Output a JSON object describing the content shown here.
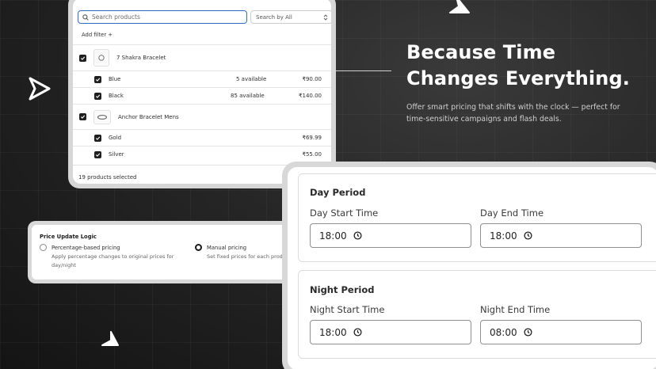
{
  "search": {
    "placeholder": "Search products",
    "filter_label": "Search by All",
    "add_filter": "Add filter +"
  },
  "products": [
    {
      "name": "7 Shakra Bracelet",
      "variants": [
        {
          "name": "Blue",
          "available": "5 available",
          "price": "₹90.00"
        },
        {
          "name": "Black",
          "available": "85 available",
          "price": "₹140.00"
        }
      ]
    },
    {
      "name": "Anchor Bracelet Mens",
      "variants": [
        {
          "name": "Gold",
          "available": "",
          "price": "₹69.99"
        },
        {
          "name": "Silver",
          "available": "",
          "price": "₹55.00"
        }
      ]
    }
  ],
  "footer": {
    "selected": "19 products selected"
  },
  "headline": {
    "line1": "Because Time",
    "line2": "Changes Everything.",
    "subtext": "Offer smart pricing that shifts with the clock — perfect for time-sensitive campaigns and flash deals."
  },
  "price_logic": {
    "title": "Price Update Logic",
    "options": [
      {
        "label": "Percentage-based pricing",
        "desc": "Apply percentage changes to original prices for day/night",
        "selected": false
      },
      {
        "label": "Manual pricing",
        "desc": "Set fixed prices for each product variant",
        "selected": true
      }
    ]
  },
  "day_period": {
    "title": "Day Period",
    "start_label": "Day Start Time",
    "start_value": "18:00",
    "end_label": "Day End Time",
    "end_value": "18:00"
  },
  "night_period": {
    "title": "Night Period",
    "start_label": "Night Start Time",
    "start_value": "18:00",
    "end_label": "Night End Time",
    "end_value": "08:00"
  },
  "colors": {
    "accent": "#2c6ecb",
    "background": "#1e1e1e",
    "checkbox": "#1f1f1f"
  }
}
